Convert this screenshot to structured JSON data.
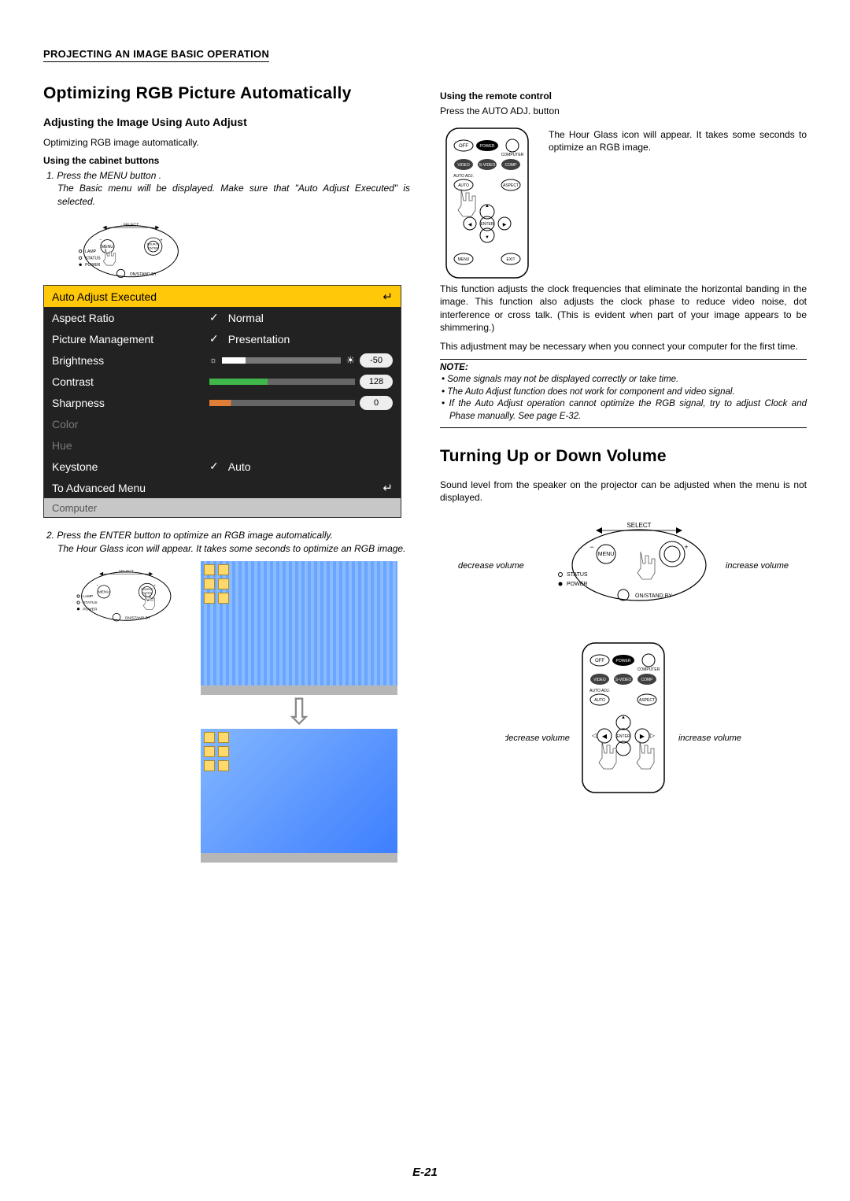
{
  "breadcrumb": "PROJECTING AN IMAGE BASIC OPERATION",
  "left": {
    "title": "Optimizing RGB Picture Automatically",
    "subhead": "Adjusting the Image Using Auto Adjust",
    "intro": "Optimizing RGB image automatically.",
    "method1_title": "Using the cabinet buttons",
    "step1": "1. Press the MENU button .",
    "step1_detail": "The Basic menu will be displayed. Make sure that \"Auto Adjust Executed\" is selected.",
    "menu": {
      "rows": [
        {
          "label": "Auto Adjust Executed",
          "type": "highlight"
        },
        {
          "label": "Aspect Ratio",
          "value": "Normal",
          "check": true,
          "type": "dark"
        },
        {
          "label": "Picture Management",
          "value": "Presentation",
          "check": true,
          "type": "dark"
        },
        {
          "label": "Brightness",
          "slider": "brightness",
          "val": "-50",
          "type": "dark"
        },
        {
          "label": "Contrast",
          "slider": "contrast",
          "val": "128",
          "type": "dark"
        },
        {
          "label": "Sharpness",
          "slider": "sharpness",
          "val": "0",
          "type": "dark"
        },
        {
          "label": "Color",
          "type": "dark disabled"
        },
        {
          "label": "Hue",
          "type": "dark disabled"
        },
        {
          "label": "Keystone",
          "value": "Auto",
          "check": true,
          "type": "dark"
        },
        {
          "label": "To Advanced Menu",
          "type": "dark",
          "enter": true
        },
        {
          "label": "Computer",
          "type": "footer"
        }
      ]
    },
    "step2": "2. Press the ENTER button to optimize an RGB image automatically.",
    "step2_detail": "The Hour Glass icon will appear. It takes some seconds to optimize an RGB image."
  },
  "right": {
    "method2_title": "Using the remote control",
    "method2_line": "Press the AUTO ADJ. button",
    "hourglass_note": "The Hour Glass icon will appear. It takes some seconds to optimize an RGB image.",
    "para1": "This function adjusts the clock frequencies that eliminate the horizontal banding in the image. This function also adjusts the clock phase to reduce video noise, dot interference or cross talk. (This is evident when part of your image appears to be shimmering.)",
    "para2": "This adjustment may be necessary when you connect your computer for the first time.",
    "note_title": "NOTE:",
    "notes": [
      "Some signals may not be displayed correctly or take time.",
      "The Auto Adjust function does not work for component and video signal.",
      "If the Auto Adjust operation cannot optimize the RGB signal, try to adjust Clock and Phase manually. See page E-32."
    ],
    "volume_title": "Turning Up or Down Volume",
    "volume_intro": "Sound level from the speaker on the projector can be adjusted when the menu is not displayed.",
    "decrease": "decrease volume",
    "increase": "increase volume"
  },
  "cabinet_labels": {
    "select": "SELECT",
    "menu": "MENU",
    "lamp": "LAMP",
    "status": "STATUS",
    "power": "POWER",
    "standby": "ON/STAND BY",
    "source": "SOURCE",
    "enter": "ENTER"
  },
  "remote_labels": {
    "off": "OFF",
    "power": "POWER",
    "computer": "COMPUTER",
    "video": "VIDEO",
    "svideo": "S-VIDEO",
    "comp": "COMP",
    "autoadj": "AUTO ADJ.",
    "auto": "AUTO",
    "aspect": "ASPECT",
    "enter": "ENTER",
    "menu": "MENU",
    "exit": "EXIT"
  },
  "page": "E-21"
}
